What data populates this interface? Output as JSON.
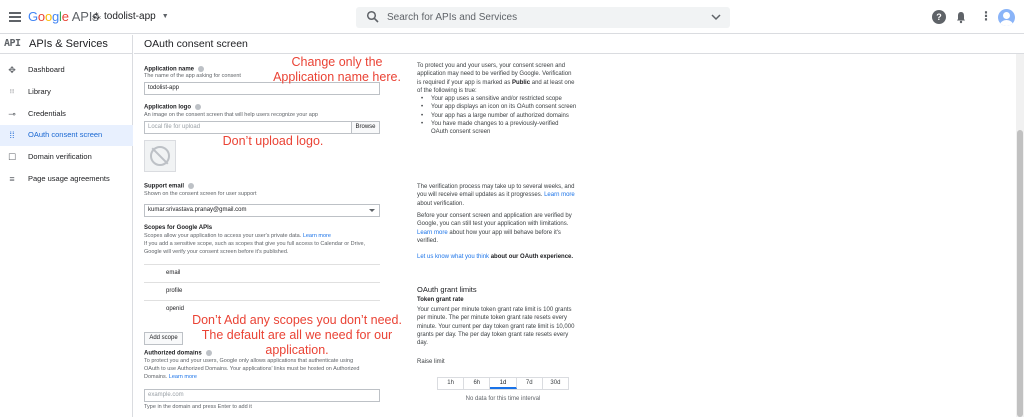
{
  "topbar": {
    "logo_letters": [
      "G",
      "o",
      "o",
      "g",
      "l",
      "e"
    ],
    "logo_suffix": "APIs",
    "project_name": "todolist-app",
    "search_placeholder": "Search for APIs and Services",
    "help_glyph": "?",
    "menu_glyph": "⋮"
  },
  "sidebar": {
    "badge": "API",
    "title": "APIs & Services",
    "items": [
      {
        "label": "Dashboard",
        "icon": "dashboard-icon",
        "glyph": "✥"
      },
      {
        "label": "Library",
        "icon": "library-icon",
        "glyph": "⦙⦙⦙"
      },
      {
        "label": "Credentials",
        "icon": "key-icon",
        "glyph": "⊸"
      },
      {
        "label": "OAuth consent screen",
        "icon": "consent-icon",
        "glyph": "⁞⁞"
      },
      {
        "label": "Domain verification",
        "icon": "domain-icon",
        "glyph": "☐"
      },
      {
        "label": "Page usage agreements",
        "icon": "settings-list-icon",
        "glyph": "≡"
      }
    ],
    "active_index": 3
  },
  "page": {
    "title": "OAuth consent screen"
  },
  "form": {
    "app_name_label": "Application name",
    "app_name_hint": "The name of the app asking for consent",
    "app_name_value": "todolist-app",
    "logo_label": "Application logo",
    "logo_hint": "An image on the consent screen that will help users recognize your app",
    "logo_placeholder": "Local file for upload",
    "browse_label": "Browse",
    "support_email_label": "Support email",
    "support_email_hint": "Shown on the consent screen for user support",
    "support_email_value": "kumar.srivastava.pranay@gmail.com",
    "scopes_label": "Scopes for Google APIs",
    "scopes_hint_1": "Scopes allow your application to access your user's private data.",
    "scopes_hint_link": "Learn more",
    "scopes_hint_2": "If you add a sensitive scope, such as scopes that give you full access to Calendar or Drive,",
    "scopes_hint_3": "Google will verify your consent screen before it's published.",
    "scopes": [
      "email",
      "profile",
      "openid"
    ],
    "add_scope_label": "Add scope",
    "authorized_domains_label": "Authorized domains",
    "authorized_domains_hint_1": "To protect you and your users, Google only allows applications that authenticate using",
    "authorized_domains_hint_2": "OAuth to use Authorized Domains. Your applications' links must be hosted on Authorized",
    "authorized_domains_hint_3": "Domains.",
    "authorized_domains_link": "Learn more",
    "domain_placeholder": "example.com",
    "domain_hint": "Type in the domain and press Enter to add it"
  },
  "info": {
    "p1_a": "To protect you and your users, your consent screen and application may need to be verified by Google. Verification is required if your app is marked as",
    "p1_bold": "Public",
    "p1_b": "and at least one of the following is true:",
    "bullets": [
      "Your app uses a sensitive and/or restricted scope",
      "Your app displays an icon on its OAuth consent screen",
      "Your app has a large number of authorized domains",
      "You have made changes to a previously-verified OAuth consent screen"
    ],
    "p2_a": "The verification process may take up to several weeks, and you will receive email updates as it progresses.",
    "p2_link": "Learn more",
    "p2_b": "about verification.",
    "p3_a": "Before your consent screen and application are verified by Google, you can still test your application with limitations.",
    "p3_link": "Learn more",
    "p3_b": "about how your app will behave before it's verified.",
    "feedback_link": "Let us know what you think",
    "feedback_rest": "about our OAuth experience.",
    "limits_heading": "OAuth grant limits",
    "token_rate_label": "Token grant rate",
    "token_rate_text": "Your current per minute token grant rate limit is 100 grants per minute. The per minute token grant rate resets every minute. Your current per day token grant rate limit is 10,000 grants per day. The per day token grant rate resets every day.",
    "raise_limit": "Raise limit",
    "intervals": [
      "1h",
      "6h",
      "1d",
      "7d",
      "30d"
    ],
    "selected_interval": "1d",
    "no_data": "No data for this time interval"
  },
  "annotations": {
    "name_note_1": "Change only the",
    "name_note_2": "Application name here.",
    "logo_note": "Don’t upload logo.",
    "scope_note_1": "Don’t Add any scopes you don’t need.",
    "scope_note_2": "The default are all we need for our",
    "scope_note_3": "application."
  },
  "colors": {
    "accent": "#1a73e8",
    "annotation": "#ea4335",
    "active_bg": "#e8f0fe"
  }
}
